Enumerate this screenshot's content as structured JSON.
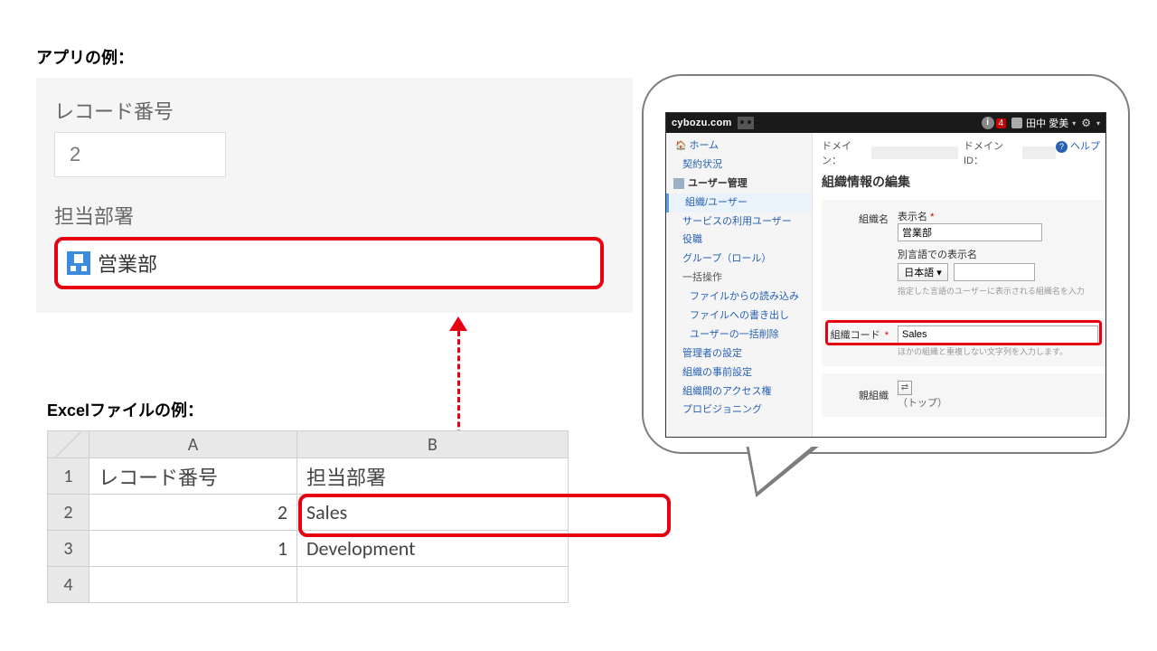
{
  "app": {
    "section_title": "アプリの例：",
    "record_label": "レコード番号",
    "record_value": "2",
    "dept_label": "担当部署",
    "dept_value": "営業部"
  },
  "excel": {
    "section_title": "Excelファイルの例：",
    "cols": {
      "A": "A",
      "B": "B"
    },
    "rows": [
      {
        "n": "1",
        "a": "レコード番号",
        "b": "担当部署"
      },
      {
        "n": "2",
        "a": "2",
        "b": "Sales"
      },
      {
        "n": "3",
        "a": "1",
        "b": "Development"
      },
      {
        "n": "4",
        "a": "",
        "b": ""
      }
    ]
  },
  "admin": {
    "brand": "cybozu.com",
    "badge": "4",
    "user": "田中 愛美",
    "info_glyph": "i",
    "caret": "▾",
    "side": {
      "home": "ホーム",
      "contract": "契約状況",
      "user_mgmt": "ユーザー管理",
      "org_user": "組織/ユーザー",
      "service_users": "サービスの利用ユーザー",
      "roles": "役職",
      "groups": "グループ（ロール）",
      "bulk": "一括操作",
      "bulk_import": "ファイルからの読み込み",
      "bulk_export": "ファイルへの書き出し",
      "bulk_delete": "ユーザーの一括削除",
      "admin_settings": "管理者の設定",
      "org_presets": "組織の事前設定",
      "org_access": "組織間のアクセス権",
      "provisioning": "プロビジョニング"
    },
    "main": {
      "domain_label": "ドメイン：",
      "domain_id_label": "ドメインID：",
      "help": "ヘルプ",
      "title": "組織情報の編集",
      "org_name_label": "組織名",
      "display_name_label": "表示名",
      "display_name_value": "営業部",
      "alt_lang_label": "別言語での表示名",
      "lang_sel": "日本語 ▾",
      "alt_lang_hint": "指定した言語のユーザーに表示される組織名を入力",
      "org_code_label": "組織コード",
      "org_code_value": "Sales",
      "org_code_hint": "ほかの組織と重複しない文字列を入力します。",
      "parent_label": "親組織",
      "parent_glyph": "⇄",
      "parent_value": "（トップ）"
    }
  }
}
